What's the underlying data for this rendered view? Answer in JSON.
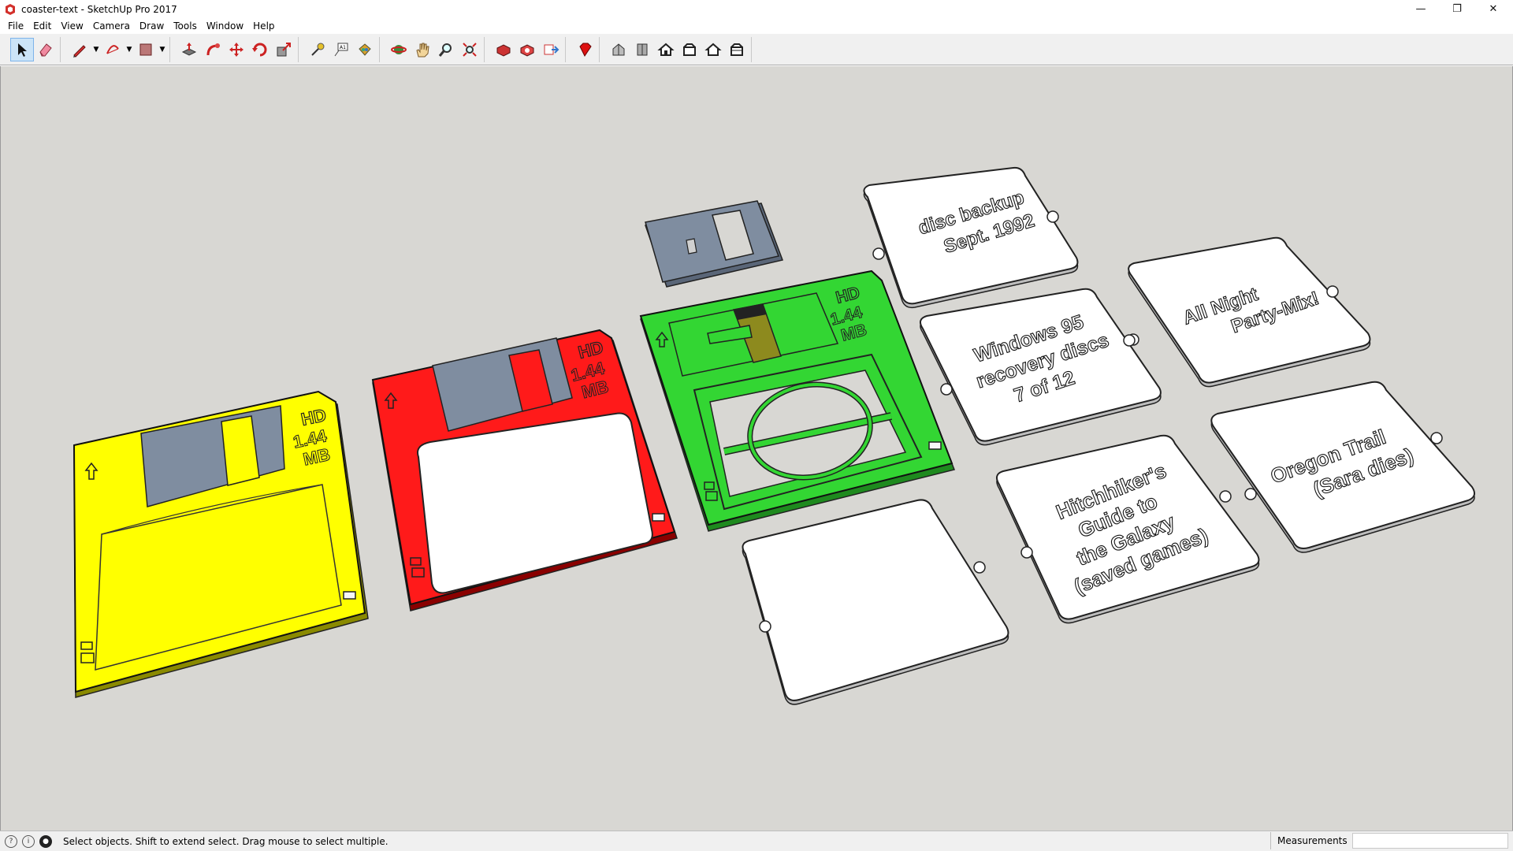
{
  "window": {
    "title": "coaster-text - SketchUp Pro 2017",
    "controls": [
      "—",
      "❐",
      "✕"
    ]
  },
  "menu": [
    "File",
    "Edit",
    "View",
    "Camera",
    "Draw",
    "Tools",
    "Window",
    "Help"
  ],
  "toolbar": {
    "tools": [
      "select",
      "eraser",
      "line",
      "arc",
      "shape",
      "push-pull",
      "follow-me",
      "move",
      "rotate",
      "scale",
      "tape-measure",
      "text",
      "paint-bucket",
      "orbit",
      "pan",
      "zoom",
      "zoom-extents",
      "warehouse",
      "extension-warehouse",
      "layout",
      "ruby",
      "iso-view",
      "top-view",
      "front-view",
      "right-view",
      "back-view",
      "left-view"
    ]
  },
  "disks": [
    {
      "color": "#ffff00",
      "hd": "HD",
      "capacity": "1.44",
      "unit": "MB"
    },
    {
      "color": "#ff1a1a",
      "hd": "HD",
      "capacity": "1.44",
      "unit": "MB"
    },
    {
      "color": "#33d633",
      "hd": "HD",
      "capacity": "1.44",
      "unit": "MB"
    }
  ],
  "labels": [
    {
      "lines": [
        "disc backup",
        "Sept. 1992"
      ]
    },
    {
      "lines": [
        "All Night",
        "Party-Mix!"
      ]
    },
    {
      "lines": [
        "Windows 95",
        "recovery discs",
        "7 of 12"
      ]
    },
    {
      "lines": [
        "Oregon Trail",
        "(Sara dies)"
      ]
    },
    {
      "lines": [
        "Hitchhiker's",
        "Guide to",
        "the Galaxy",
        "(saved games)"
      ]
    },
    {
      "lines": []
    }
  ],
  "status": {
    "message": "Select objects. Shift to extend select. Drag mouse to select multiple.",
    "measurements_label": "Measurements",
    "measurements_value": ""
  }
}
